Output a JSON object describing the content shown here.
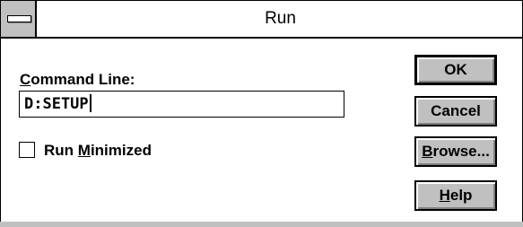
{
  "window": {
    "title": "Run"
  },
  "command_line": {
    "label_accel": "C",
    "label_rest": "ommand Line:",
    "value": "D:SETUP"
  },
  "run_minimized": {
    "label_before": "Run ",
    "label_accel": "M",
    "label_after": "inimized",
    "checked": false
  },
  "buttons": {
    "ok": "OK",
    "cancel": "Cancel",
    "browse_accel": "B",
    "browse_rest": "rowse...",
    "help_accel": "H",
    "help_rest": "elp"
  },
  "colors": {
    "face": "#c0c0c0",
    "shadow": "#808080",
    "highlight": "#ffffff",
    "text": "#000000"
  }
}
